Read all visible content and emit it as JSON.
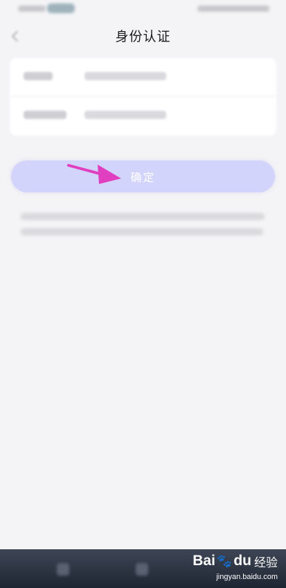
{
  "header": {
    "title": "身份认证"
  },
  "form": {
    "rows": [
      {
        "label": "",
        "value": ""
      },
      {
        "label": "",
        "value": ""
      }
    ]
  },
  "confirm_button": {
    "label": "确定"
  },
  "annotation": {
    "arrow_color": "#e040c0"
  },
  "watermark": {
    "logo": "Bai",
    "logo_suffix": "du",
    "brand": "经验",
    "url": "jingyan.baidu.com"
  },
  "colors": {
    "background": "#f4f4f6",
    "button_bg": "#d3d4fb",
    "bottom_nav": "#1e2532"
  }
}
